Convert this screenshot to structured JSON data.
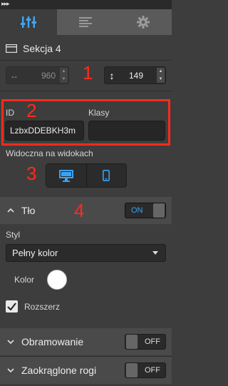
{
  "toolbar": {
    "arrows_glyph": "▸▸▸"
  },
  "tabs": [
    {
      "icon": "sliders-icon",
      "active": true
    },
    {
      "icon": "align-left-icon",
      "active": false
    },
    {
      "icon": "gear-icon",
      "active": false
    }
  ],
  "section": {
    "title": "Sekcja 4",
    "icon": "section-icon"
  },
  "size": {
    "width_value": "960",
    "height_value": "149"
  },
  "annotations": {
    "n1": "1",
    "n2": "2",
    "n3": "3",
    "n4": "4"
  },
  "attributes": {
    "id_label": "ID",
    "id_value": "LzbxDDEBKH3m",
    "classes_label": "Klasy",
    "classes_value": ""
  },
  "visibility": {
    "label": "Widoczna na widokach",
    "devices": [
      "desktop-icon",
      "mobile-icon"
    ]
  },
  "background": {
    "title": "Tło",
    "toggle_label": "ON",
    "style_label": "Styl",
    "style_value": "Pełny kolor",
    "color_label": "Kolor",
    "color_value": "#ffffff",
    "extend_label": "Rozszerz",
    "extend_checked": true
  },
  "border": {
    "title": "Obramowanie",
    "toggle_label": "OFF"
  },
  "rounded": {
    "title": "Zaokrąglone rogi",
    "toggle_label": "OFF"
  },
  "colors": {
    "accent_red": "#ff2b1c",
    "toggle_on": "#3ba5f3"
  }
}
